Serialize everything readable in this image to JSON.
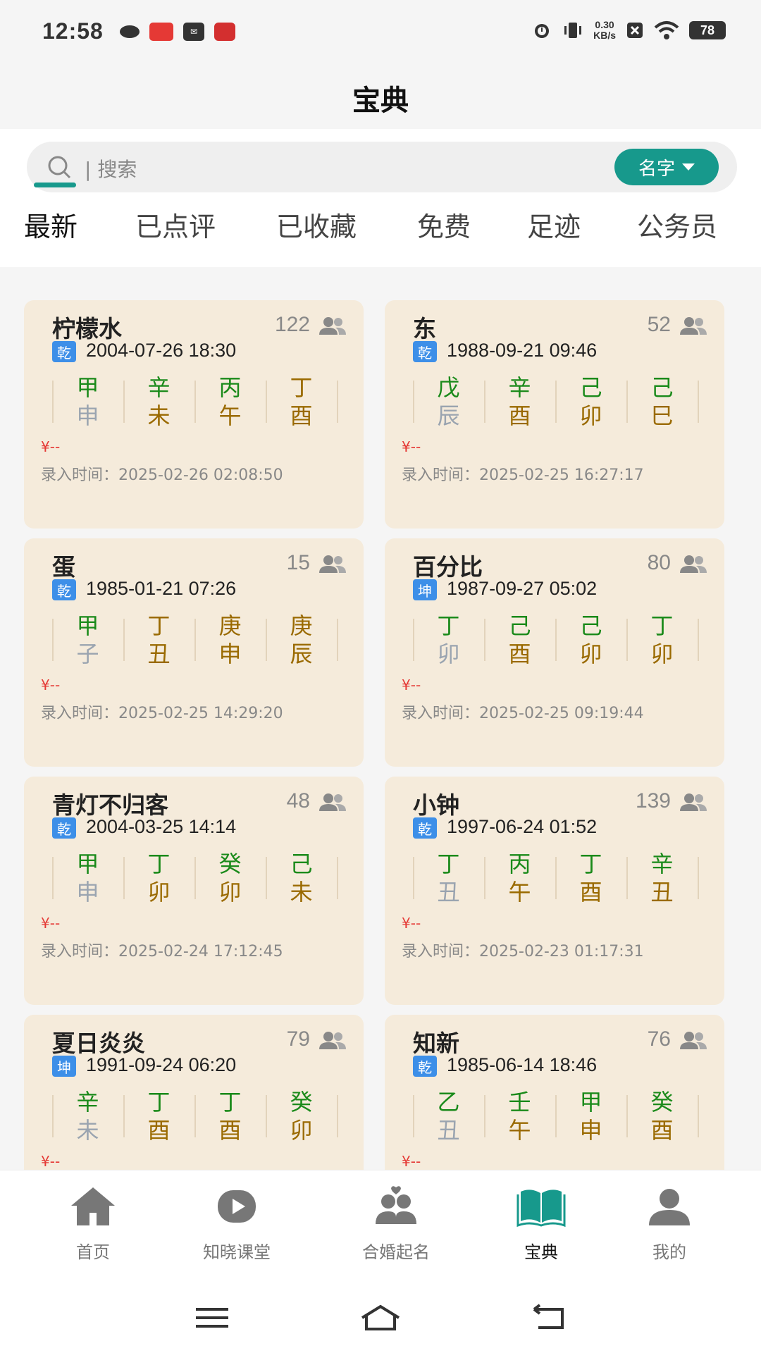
{
  "status": {
    "time": "12:58",
    "netspeed_value": "0.30",
    "netspeed_unit": "KB/s",
    "battery": "78"
  },
  "header": {
    "title": "宝典"
  },
  "search": {
    "placeholder": "| 搜索",
    "filter_label": "名字"
  },
  "tabs": [
    {
      "label": "最新",
      "active": true
    },
    {
      "label": "已点评"
    },
    {
      "label": "已收藏"
    },
    {
      "label": "免费"
    },
    {
      "label": "足迹"
    },
    {
      "label": "公务员"
    }
  ],
  "colors": {
    "accent": "#17998c",
    "green": "#1a8a1a",
    "brown": "#9a6a00",
    "gray": "#9aa4b0",
    "qian": "#3d8fe8",
    "kun": "#3d8fe8"
  },
  "cards": [
    {
      "name": "柠檬水",
      "count": "122",
      "gender": "乾",
      "birth": "2004-07-26 18:30",
      "stems": [
        "甲",
        "辛",
        "丙",
        "丁"
      ],
      "stem_colors": [
        "green",
        "green",
        "green",
        "brown"
      ],
      "branches": [
        "申",
        "未",
        "午",
        "酉"
      ],
      "branch_colors": [
        "gray",
        "brown",
        "brown",
        "brown"
      ],
      "price": "¥--",
      "entry_label": "录入时间：",
      "entry_time": "2025-02-26 02:08:50"
    },
    {
      "name": "东",
      "count": "52",
      "gender": "乾",
      "birth": "1988-09-21 09:46",
      "stems": [
        "戊",
        "辛",
        "己",
        "己"
      ],
      "stem_colors": [
        "green",
        "green",
        "green",
        "green"
      ],
      "branches": [
        "辰",
        "酉",
        "卯",
        "巳"
      ],
      "branch_colors": [
        "gray",
        "brown",
        "brown",
        "brown"
      ],
      "price": "¥--",
      "entry_label": "录入时间：",
      "entry_time": "2025-02-25 16:27:17"
    },
    {
      "name": "蛋",
      "count": "15",
      "gender": "乾",
      "birth": "1985-01-21 07:26",
      "stems": [
        "甲",
        "丁",
        "庚",
        "庚"
      ],
      "stem_colors": [
        "green",
        "brown",
        "brown",
        "brown"
      ],
      "branches": [
        "子",
        "丑",
        "申",
        "辰"
      ],
      "branch_colors": [
        "gray",
        "brown",
        "brown",
        "brown"
      ],
      "price": "¥--",
      "entry_label": "录入时间：",
      "entry_time": "2025-02-25 14:29:20"
    },
    {
      "name": "百分比",
      "count": "80",
      "gender": "坤",
      "birth": "1987-09-27 05:02",
      "stems": [
        "丁",
        "己",
        "己",
        "丁"
      ],
      "stem_colors": [
        "green",
        "green",
        "green",
        "green"
      ],
      "branches": [
        "卯",
        "酉",
        "卯",
        "卯"
      ],
      "branch_colors": [
        "gray",
        "brown",
        "brown",
        "brown"
      ],
      "price": "¥--",
      "entry_label": "录入时间：",
      "entry_time": "2025-02-25 09:19:44"
    },
    {
      "name": "青灯不归客",
      "count": "48",
      "gender": "乾",
      "birth": "2004-03-25 14:14",
      "stems": [
        "甲",
        "丁",
        "癸",
        "己"
      ],
      "stem_colors": [
        "green",
        "green",
        "green",
        "green"
      ],
      "branches": [
        "申",
        "卯",
        "卯",
        "未"
      ],
      "branch_colors": [
        "gray",
        "brown",
        "brown",
        "brown"
      ],
      "price": "¥--",
      "entry_label": "录入时间：",
      "entry_time": "2025-02-24 17:12:45"
    },
    {
      "name": "小钟",
      "count": "139",
      "gender": "乾",
      "birth": "1997-06-24 01:52",
      "stems": [
        "丁",
        "丙",
        "丁",
        "辛"
      ],
      "stem_colors": [
        "green",
        "green",
        "green",
        "green"
      ],
      "branches": [
        "丑",
        "午",
        "酉",
        "丑"
      ],
      "branch_colors": [
        "gray",
        "brown",
        "brown",
        "brown"
      ],
      "price": "¥--",
      "entry_label": "录入时间：",
      "entry_time": "2025-02-23 01:17:31"
    },
    {
      "name": "夏日炎炎",
      "count": "79",
      "gender": "坤",
      "birth": "1991-09-24 06:20",
      "stems": [
        "辛",
        "丁",
        "丁",
        "癸"
      ],
      "stem_colors": [
        "green",
        "green",
        "green",
        "green"
      ],
      "branches": [
        "未",
        "酉",
        "酉",
        "卯"
      ],
      "branch_colors": [
        "gray",
        "brown",
        "brown",
        "brown"
      ],
      "price": "¥--",
      "entry_label": "",
      "entry_time": ""
    },
    {
      "name": "知新",
      "count": "76",
      "gender": "乾",
      "birth": "1985-06-14 18:46",
      "stems": [
        "乙",
        "壬",
        "甲",
        "癸"
      ],
      "stem_colors": [
        "green",
        "green",
        "green",
        "green"
      ],
      "branches": [
        "丑",
        "午",
        "申",
        "酉"
      ],
      "branch_colors": [
        "gray",
        "brown",
        "brown",
        "brown"
      ],
      "price": "¥--",
      "entry_label": "",
      "entry_time": ""
    }
  ],
  "nav": [
    {
      "label": "首页",
      "icon": "home-icon"
    },
    {
      "label": "知晓课堂",
      "icon": "play-icon"
    },
    {
      "label": "合婚起名",
      "icon": "couple-icon"
    },
    {
      "label": "宝典",
      "icon": "book-icon",
      "active": true
    },
    {
      "label": "我的",
      "icon": "person-icon"
    }
  ]
}
